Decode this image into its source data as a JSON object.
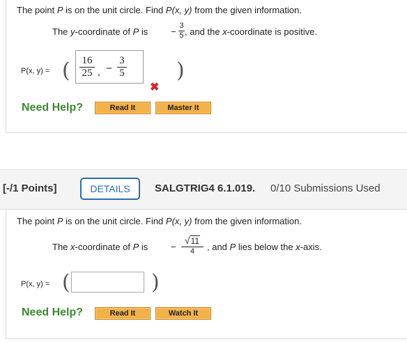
{
  "q1": {
    "prompt_a": "The point ",
    "prompt_p": "P",
    "prompt_b": " is on the unit circle. Find ",
    "prompt_func": "P(x, y)",
    "prompt_c": " from the given information.",
    "given_a": "The ",
    "given_var": "y",
    "given_b": "-coordinate of ",
    "given_p": "P",
    "given_c": " is",
    "given_minus": "−",
    "given_num": "3",
    "given_den": "5",
    "given_tail_a": ", and the ",
    "given_tail_var": "x",
    "given_tail_b": "-coordinate is positive.",
    "answer_label": "P(x, y) =",
    "paren_open": "(",
    "paren_close": ")",
    "answer_x_num": "16",
    "answer_x_den": "25",
    "comma": ",",
    "answer_minus": "−",
    "answer_y_num": "3",
    "answer_y_den": "5",
    "status_icon": "✖",
    "need_help": "Need Help?",
    "read_it": "Read It",
    "master_it": "Master It"
  },
  "header": {
    "points": "[-/1 Points]",
    "details": "DETAILS",
    "code": "SALGTRIG4 6.1.019.",
    "submissions": "0/10 Submissions Used"
  },
  "q2": {
    "prompt_a": "The point ",
    "prompt_p": "P",
    "prompt_b": " is on the unit circle. Find ",
    "prompt_func": "P(x, y)",
    "prompt_c": " from the given information.",
    "given_a": "The ",
    "given_var": "x",
    "given_b": "-coordinate of ",
    "given_p": "P",
    "given_c": " is",
    "given_minus": "−",
    "given_sqrt": "√",
    "given_radicand": "11",
    "given_den": "4",
    "given_tail_a": ", and ",
    "given_tail_p": "P",
    "given_tail_b": " lies below the ",
    "given_tail_var": "x",
    "given_tail_c": "-axis.",
    "answer_label": "P(x, y) =",
    "paren_open": "(",
    "paren_close": ")",
    "answer_value": "",
    "need_help": "Need Help?",
    "read_it": "Read It",
    "watch_it": "Watch It"
  },
  "colors": {
    "help_green": "#3a8a2f",
    "button_orange": "#f2b24a",
    "details_blue": "#2a6db0",
    "wrong_red": "#d6262b"
  }
}
